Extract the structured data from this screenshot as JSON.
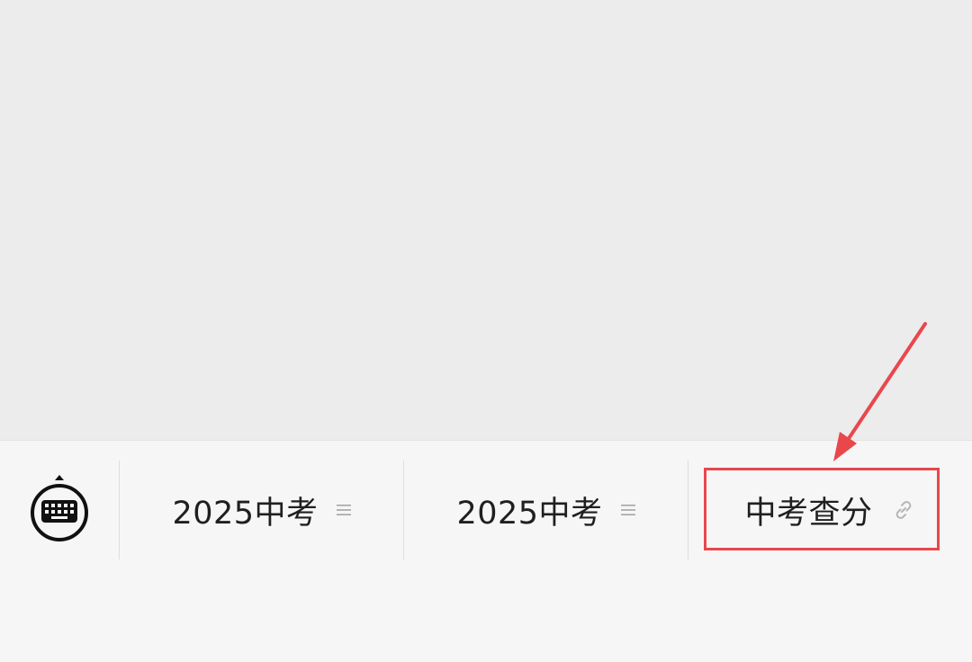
{
  "menu": {
    "items": [
      {
        "label": "2025中考",
        "icon": "hamburger-icon"
      },
      {
        "label": "2025中考",
        "icon": "hamburger-icon"
      },
      {
        "label": "中考查分",
        "icon": "link-icon"
      }
    ]
  },
  "icons": {
    "keyboard_toggle": "keyboard-icon"
  },
  "colors": {
    "highlight": "#e8474c",
    "bar_background": "#f6f6f6",
    "chat_background": "#ececec"
  }
}
